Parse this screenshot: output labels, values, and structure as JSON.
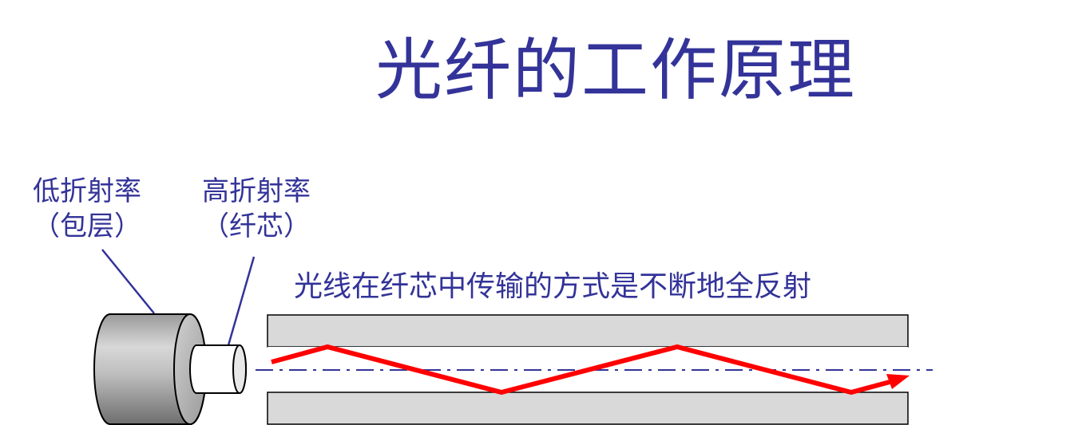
{
  "title": "光纤的工作原理",
  "labels": {
    "cladding": {
      "line1": "低折射率",
      "line2": "（包层）"
    },
    "core": {
      "line1": "高折射率",
      "line2": "（纤芯）"
    }
  },
  "caption": "光线在纤芯中传输的方式是不断地全反射",
  "colors": {
    "text": "#333399",
    "ray": "#ff0000",
    "cladding_band": "#d9d9d9",
    "axis_line": "#333399"
  }
}
